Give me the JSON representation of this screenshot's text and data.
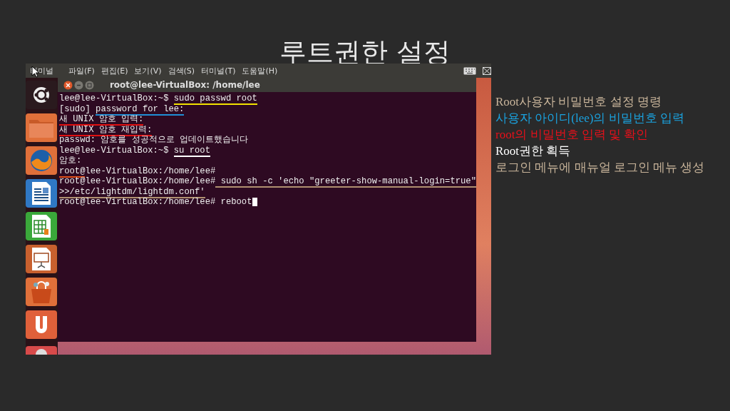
{
  "slide_title": "루트권한 설정",
  "screenshot": {
    "top_bar": {
      "app_name": "터미널",
      "menus": [
        "파일(F)",
        "편집(E)",
        "보기(V)",
        "검색(S)",
        "터미널(T)",
        "도움말(H)"
      ]
    },
    "terminal": {
      "title": "root@lee-VirtualBox: /home/lee",
      "lines": [
        {
          "segments": [
            {
              "text": "lee@lee-VirtualBox:~$ "
            },
            {
              "text": "sudo passwd root",
              "color": "#f2e200"
            }
          ]
        },
        {
          "segments": [
            {
              "text": "[sudo] "
            },
            {
              "text": "password for lee:",
              "color": "#1e8fd6"
            }
          ]
        },
        {
          "segments": [
            {
              "text": "새 UNIX 암호 입력:",
              "color": "#e01010"
            }
          ]
        },
        {
          "segments": [
            {
              "text": "새 UNIX 암호 재입력:",
              "color": "#e01010"
            }
          ]
        },
        {
          "segments": [
            {
              "text": "passwd: 암호를 성공적으로 업데이트했습니다"
            }
          ]
        },
        {
          "segments": [
            {
              "text": "lee@lee-VirtualBox:~$ "
            },
            {
              "text": "su root",
              "color": "#ffffff"
            }
          ]
        },
        {
          "segments": [
            {
              "text": "암호:"
            }
          ]
        },
        {
          "segments": [
            {
              "text": "root@",
              "color": "#e0501a"
            },
            {
              "text": "lee-VirtualBox:/home/lee#"
            }
          ]
        },
        {
          "segments": [
            {
              "text": "root@lee-VirtualBox:/home/lee#"
            },
            {
              "text": " sudo sh -c 'echo \"greeter-show-manual-login=true\"",
              "color": "#b09070"
            }
          ]
        },
        {
          "segments": [
            {
              "text": ">>/etc/lightdm/lightdm.conf'",
              "color": "#b09070"
            }
          ]
        },
        {
          "segments": [
            {
              "text": "root@lee-VirtualBox:/home/lee# reboot"
            }
          ],
          "cursor": true
        }
      ]
    }
  },
  "notes": [
    {
      "text": "Root사용자 비밀번호 설정 명령",
      "color": "#c8b49a"
    },
    {
      "text": "사용자 아이디(lee)의 비밀번호 입력",
      "color": "#1aa3e0"
    },
    {
      "text": "root의 비밀번호 입력 및 확인",
      "color": "#e8101a"
    },
    {
      "text": "Root권한 획득",
      "color": "#ffffff"
    },
    {
      "text": "로그인 메뉴에 매뉴얼 로그인 메뉴 생성",
      "color": "#c8b49a"
    }
  ]
}
